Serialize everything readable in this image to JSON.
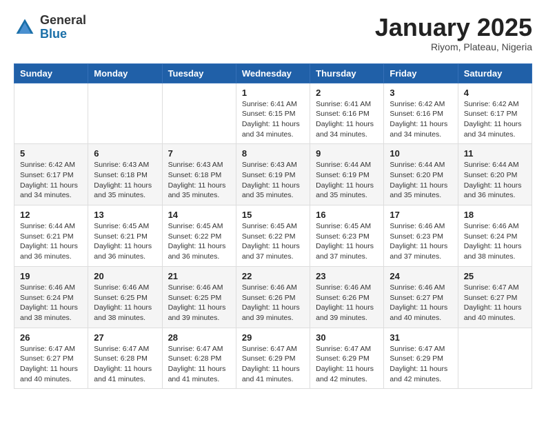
{
  "logo": {
    "general": "General",
    "blue": "Blue"
  },
  "header": {
    "month_year": "January 2025",
    "location": "Riyom, Plateau, Nigeria"
  },
  "days_of_week": [
    "Sunday",
    "Monday",
    "Tuesday",
    "Wednesday",
    "Thursday",
    "Friday",
    "Saturday"
  ],
  "weeks": [
    [
      {
        "date": "",
        "info": ""
      },
      {
        "date": "",
        "info": ""
      },
      {
        "date": "",
        "info": ""
      },
      {
        "date": "1",
        "info": "Sunrise: 6:41 AM\nSunset: 6:15 PM\nDaylight: 11 hours and 34 minutes."
      },
      {
        "date": "2",
        "info": "Sunrise: 6:41 AM\nSunset: 6:16 PM\nDaylight: 11 hours and 34 minutes."
      },
      {
        "date": "3",
        "info": "Sunrise: 6:42 AM\nSunset: 6:16 PM\nDaylight: 11 hours and 34 minutes."
      },
      {
        "date": "4",
        "info": "Sunrise: 6:42 AM\nSunset: 6:17 PM\nDaylight: 11 hours and 34 minutes."
      }
    ],
    [
      {
        "date": "5",
        "info": "Sunrise: 6:42 AM\nSunset: 6:17 PM\nDaylight: 11 hours and 34 minutes."
      },
      {
        "date": "6",
        "info": "Sunrise: 6:43 AM\nSunset: 6:18 PM\nDaylight: 11 hours and 35 minutes."
      },
      {
        "date": "7",
        "info": "Sunrise: 6:43 AM\nSunset: 6:18 PM\nDaylight: 11 hours and 35 minutes."
      },
      {
        "date": "8",
        "info": "Sunrise: 6:43 AM\nSunset: 6:19 PM\nDaylight: 11 hours and 35 minutes."
      },
      {
        "date": "9",
        "info": "Sunrise: 6:44 AM\nSunset: 6:19 PM\nDaylight: 11 hours and 35 minutes."
      },
      {
        "date": "10",
        "info": "Sunrise: 6:44 AM\nSunset: 6:20 PM\nDaylight: 11 hours and 35 minutes."
      },
      {
        "date": "11",
        "info": "Sunrise: 6:44 AM\nSunset: 6:20 PM\nDaylight: 11 hours and 36 minutes."
      }
    ],
    [
      {
        "date": "12",
        "info": "Sunrise: 6:44 AM\nSunset: 6:21 PM\nDaylight: 11 hours and 36 minutes."
      },
      {
        "date": "13",
        "info": "Sunrise: 6:45 AM\nSunset: 6:21 PM\nDaylight: 11 hours and 36 minutes."
      },
      {
        "date": "14",
        "info": "Sunrise: 6:45 AM\nSunset: 6:22 PM\nDaylight: 11 hours and 36 minutes."
      },
      {
        "date": "15",
        "info": "Sunrise: 6:45 AM\nSunset: 6:22 PM\nDaylight: 11 hours and 37 minutes."
      },
      {
        "date": "16",
        "info": "Sunrise: 6:45 AM\nSunset: 6:23 PM\nDaylight: 11 hours and 37 minutes."
      },
      {
        "date": "17",
        "info": "Sunrise: 6:46 AM\nSunset: 6:23 PM\nDaylight: 11 hours and 37 minutes."
      },
      {
        "date": "18",
        "info": "Sunrise: 6:46 AM\nSunset: 6:24 PM\nDaylight: 11 hours and 38 minutes."
      }
    ],
    [
      {
        "date": "19",
        "info": "Sunrise: 6:46 AM\nSunset: 6:24 PM\nDaylight: 11 hours and 38 minutes."
      },
      {
        "date": "20",
        "info": "Sunrise: 6:46 AM\nSunset: 6:25 PM\nDaylight: 11 hours and 38 minutes."
      },
      {
        "date": "21",
        "info": "Sunrise: 6:46 AM\nSunset: 6:25 PM\nDaylight: 11 hours and 39 minutes."
      },
      {
        "date": "22",
        "info": "Sunrise: 6:46 AM\nSunset: 6:26 PM\nDaylight: 11 hours and 39 minutes."
      },
      {
        "date": "23",
        "info": "Sunrise: 6:46 AM\nSunset: 6:26 PM\nDaylight: 11 hours and 39 minutes."
      },
      {
        "date": "24",
        "info": "Sunrise: 6:46 AM\nSunset: 6:27 PM\nDaylight: 11 hours and 40 minutes."
      },
      {
        "date": "25",
        "info": "Sunrise: 6:47 AM\nSunset: 6:27 PM\nDaylight: 11 hours and 40 minutes."
      }
    ],
    [
      {
        "date": "26",
        "info": "Sunrise: 6:47 AM\nSunset: 6:27 PM\nDaylight: 11 hours and 40 minutes."
      },
      {
        "date": "27",
        "info": "Sunrise: 6:47 AM\nSunset: 6:28 PM\nDaylight: 11 hours and 41 minutes."
      },
      {
        "date": "28",
        "info": "Sunrise: 6:47 AM\nSunset: 6:28 PM\nDaylight: 11 hours and 41 minutes."
      },
      {
        "date": "29",
        "info": "Sunrise: 6:47 AM\nSunset: 6:29 PM\nDaylight: 11 hours and 41 minutes."
      },
      {
        "date": "30",
        "info": "Sunrise: 6:47 AM\nSunset: 6:29 PM\nDaylight: 11 hours and 42 minutes."
      },
      {
        "date": "31",
        "info": "Sunrise: 6:47 AM\nSunset: 6:29 PM\nDaylight: 11 hours and 42 minutes."
      },
      {
        "date": "",
        "info": ""
      }
    ]
  ]
}
